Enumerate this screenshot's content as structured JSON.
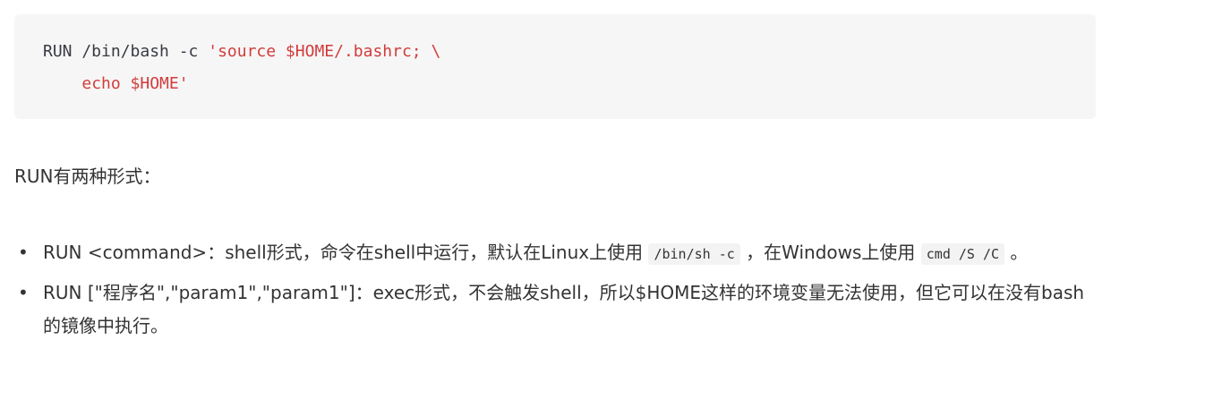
{
  "code_block": {
    "line1_plain": "RUN /bin/bash -c ",
    "line1_string": "'source $HOME/.bashrc; \\",
    "line2_indent": "    ",
    "line2_string": "echo $HOME'"
  },
  "intro": "RUN有两种形式：",
  "items": [
    {
      "text_a": "RUN <command>：shell形式，命令在shell中运行，默认在Linux上使用 ",
      "code_a": "/bin/sh -c",
      "text_b": " ，在Windows上使用 ",
      "code_b": "cmd /S /C",
      "text_c": " 。"
    },
    {
      "text": "RUN [\"程序名\",\"param1\",\"param1\"]：exec形式，不会触发shell，所以$HOME这样的环境变量无法使用，但它可以在没有bash的镜像中执行。"
    }
  ],
  "colors": {
    "code_bg": "#f6f6f6",
    "string": "#d23c3c",
    "text": "#333333"
  }
}
